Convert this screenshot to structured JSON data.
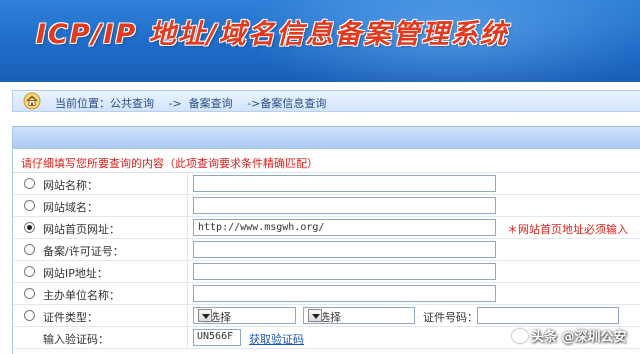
{
  "header": {
    "title": "ICP/IP 地址/域名信息备案管理系统",
    "accent_color": "#e23a1e",
    "bg_color": "#1f6cc8"
  },
  "breadcrumb": {
    "icon": "home-icon",
    "text": "当前位置：公共查询　 ->  备案查询　 ->备案信息查询"
  },
  "notice": "请仔细填写您所要查询的内容（此项查询要求条件精确匹配）",
  "form": {
    "rows": [
      {
        "label": "网站名称：",
        "value": "",
        "selected": false
      },
      {
        "label": "网站域名：",
        "value": "",
        "selected": false
      },
      {
        "label": "网站首页网址：",
        "value": "http://www.msgwh.org/",
        "selected": true,
        "hint": "＊网站首页地址必须输入"
      },
      {
        "label": "备案/许可证号：",
        "value": "",
        "selected": false
      },
      {
        "label": "网站IP地址：",
        "value": "",
        "selected": false
      },
      {
        "label": "主办单位名称：",
        "value": "",
        "selected": false
      }
    ],
    "cert": {
      "label": "证件类型：",
      "select1": "请选择",
      "select2": "请选择",
      "number_label": "证件号码：",
      "number_value": ""
    },
    "captcha": {
      "label": "输入验证码：",
      "value": "UN566F",
      "link": "获取验证码"
    }
  },
  "watermark": "头条 @深圳公安"
}
